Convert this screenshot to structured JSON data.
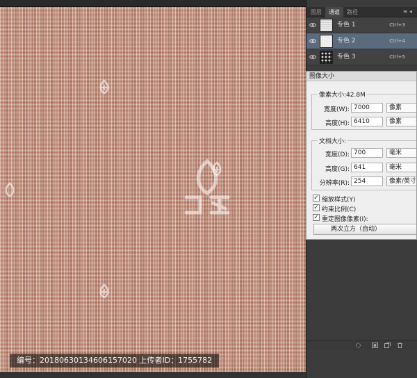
{
  "canvas": {
    "caption": "编号：20180630134606157020 上传者ID：1755782"
  },
  "channels_panel": {
    "tabs": [
      "图层",
      "通道",
      "路径"
    ],
    "active_tab": "通道",
    "menu_glyph": "≡ ◂",
    "channels": [
      {
        "name": "专色 1",
        "shortcut": "Ctrl+3",
        "selected": false
      },
      {
        "name": "专色 2",
        "shortcut": "Ctrl+4",
        "selected": true
      },
      {
        "name": "专色 3",
        "shortcut": "Ctrl+5",
        "selected": false
      }
    ]
  },
  "dialog": {
    "title": "图像大小",
    "pixel_group": {
      "legend": "像素大小:42.8M",
      "width_label": "宽度(W):",
      "width_value": "7000",
      "width_unit": "像素",
      "height_label": "高度(H):",
      "height_value": "6410",
      "height_unit": "像素"
    },
    "doc_group": {
      "legend": "文档大小:",
      "width_label": "宽度(D):",
      "width_value": "700",
      "width_unit": "毫米",
      "height_label": "高度(G):",
      "height_value": "641",
      "height_unit": "毫米",
      "res_label": "分辨率(R):",
      "res_value": "254",
      "res_unit": "像素/英寸"
    },
    "checkboxes": [
      {
        "label": "缩放样式(Y)",
        "checked": true
      },
      {
        "label": "约束比例(C)",
        "checked": true
      },
      {
        "label": "重定图像像素(I):",
        "checked": true
      }
    ],
    "resample_method": "两次立方（自动）",
    "check_glyph": "✓",
    "arrow_glyph": "▾"
  },
  "icons": [
    "eye-icon",
    "watermark-logo-icon",
    "dotted-circle-icon",
    "save-selection-icon",
    "new-channel-icon",
    "trash-icon"
  ],
  "colors": {
    "canvas_texture": "#bb8774",
    "panel_bg": "#3c3c3c",
    "selected_channel": "#5a6b7e",
    "dialog_bg": "#efefef"
  }
}
